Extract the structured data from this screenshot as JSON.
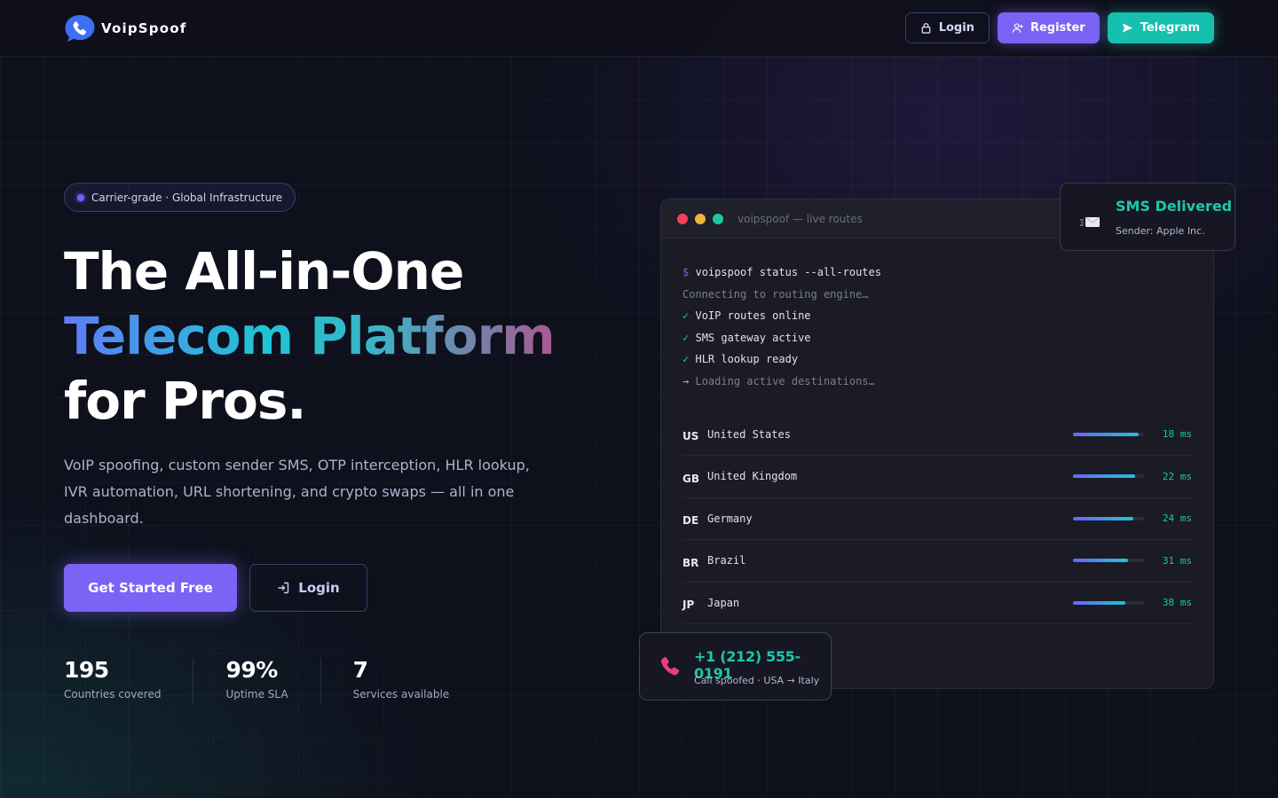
{
  "nav": {
    "brand": "VoipSpoof",
    "login_label": "Login",
    "register_label": "Register",
    "telegram_label": "Telegram"
  },
  "hero": {
    "badge": "Carrier-grade · Global Infrastructure",
    "title_line1": "The All-in-One",
    "title_line2": "Telecom Platform",
    "title_line3": "for Pros.",
    "description": "VoIP spoofing, custom sender SMS, OTP interception, HLR lookup, IVR automation, URL shortening, and crypto swaps — all in one dashboard.",
    "cta_primary": "Get Started Free",
    "cta_secondary": "Login"
  },
  "stats": [
    {
      "value": "195",
      "label": "Countries covered"
    },
    {
      "value": "99%",
      "label": "Uptime SLA"
    },
    {
      "value": "7",
      "label": "Services available"
    }
  ],
  "terminal": {
    "title": "voipspoof — live routes",
    "prompt": "$",
    "command": "voipspoof status --all-routes",
    "connecting": "Connecting to routing engine…",
    "checks": [
      "VoIP routes online",
      "SMS gateway active",
      "HLR lookup ready"
    ],
    "check_mark": "✓",
    "loading_arrow": "→",
    "loading": "Loading active destinations…",
    "routes": [
      {
        "code": "US",
        "country": "United States",
        "latency": "18 ms",
        "level": 0.92
      },
      {
        "code": "GB",
        "country": "United Kingdom",
        "latency": "22 ms",
        "level": 0.88
      },
      {
        "code": "DE",
        "country": "Germany",
        "latency": "24 ms",
        "level": 0.85
      },
      {
        "code": "BR",
        "country": "Brazil",
        "latency": "31 ms",
        "level": 0.78
      },
      {
        "code": "JP",
        "country": "Japan",
        "latency": "38 ms",
        "level": 0.74
      }
    ]
  },
  "sms_card": {
    "title": "SMS Delivered",
    "subtitle": "Sender: Apple Inc."
  },
  "call_card": {
    "title": "+1 (212) 555-0191",
    "subtitle": "Call spoofed · USA → Italy"
  },
  "colors": {
    "accent_purple": "#7b63f5",
    "accent_teal": "#17bfae",
    "success": "#1fc7a9",
    "dot_red": "#ef4257",
    "dot_yellow": "#f0b43a",
    "dot_green": "#1fc7a9"
  },
  "icons": {
    "logo": "chat-phone-icon",
    "login": "lock-icon",
    "register": "user-plus-icon",
    "telegram": "send-icon",
    "cta_login": "sign-in-icon",
    "sms": "message-icon",
    "call": "phone-icon"
  }
}
